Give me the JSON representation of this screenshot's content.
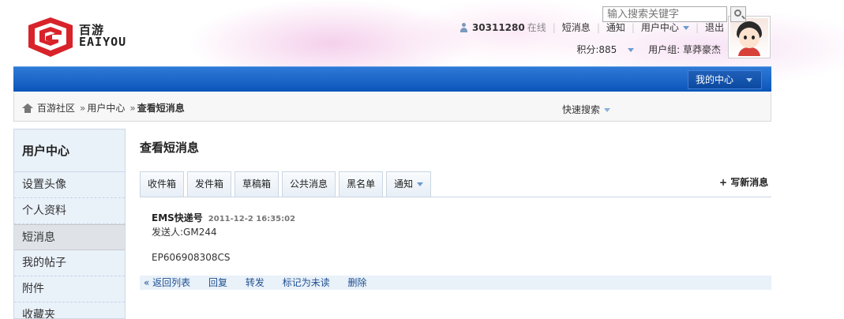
{
  "brand": {
    "name_cn": "百游",
    "name_en": "EAIYOU",
    "logo_color": "#d8232a"
  },
  "userbar": {
    "user_id": "30311280",
    "online_status": "在线",
    "links": [
      "短消息",
      "通知",
      "用户中心",
      "退出"
    ],
    "points": "积分:885",
    "user_group": "用户组: 草莽豪杰"
  },
  "nav": {
    "my_center": "我的中心"
  },
  "breadcrumb": {
    "items": [
      "百游社区",
      "用户中心",
      "查看短消息"
    ]
  },
  "search": {
    "label": "快速搜索",
    "placeholder": "输入搜索关键字"
  },
  "sidebar": {
    "title": "用户中心",
    "items": [
      {
        "label": "设置头像",
        "active": false
      },
      {
        "label": "个人资料",
        "active": false
      },
      {
        "label": "短消息",
        "active": true
      },
      {
        "label": "我的帖子",
        "active": false
      },
      {
        "label": "附件",
        "active": false
      },
      {
        "label": "收藏夹",
        "active": false
      }
    ]
  },
  "main": {
    "title": "查看短消息",
    "tabs": [
      "收件箱",
      "发件箱",
      "草稿箱",
      "公共消息",
      "黑名单",
      "通知"
    ],
    "new_message": "+ 写新消息",
    "message": {
      "subject": "EMS快递号",
      "date": "2011-12-2 16:35:02",
      "sender": "发送人:GM244",
      "body": "EP606908308CS"
    },
    "actions": [
      "« 返回列表",
      "回复",
      "转发",
      "标记为未读",
      "删除"
    ]
  },
  "colors": {
    "nav_blue": "#0a55b8",
    "sidebar_bg": "#e9f1f9",
    "link_blue": "#1f4f8f"
  }
}
